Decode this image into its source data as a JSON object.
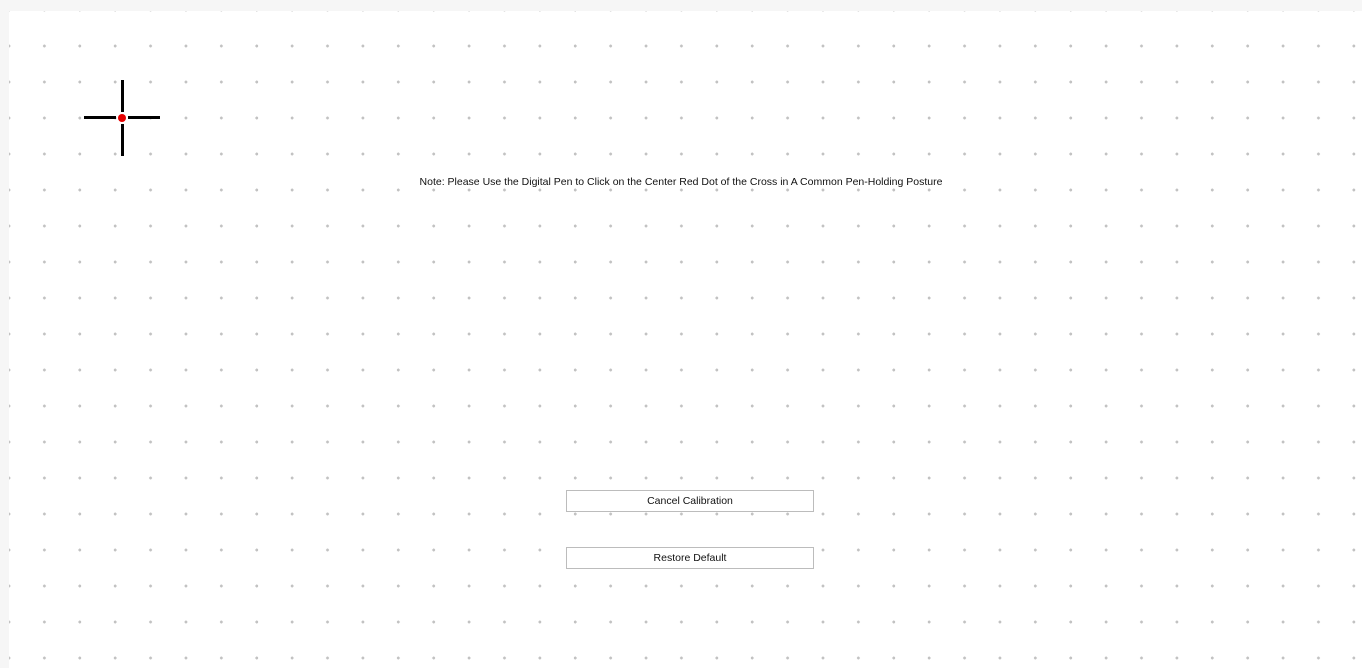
{
  "calibration": {
    "note": "Note: Please Use the Digital Pen to Click on the Center Red Dot of the Cross in A Common Pen-Holding Posture",
    "target_color": "#e60000"
  },
  "buttons": {
    "cancel_label": "Cancel Calibration",
    "restore_label": "Restore Default"
  }
}
